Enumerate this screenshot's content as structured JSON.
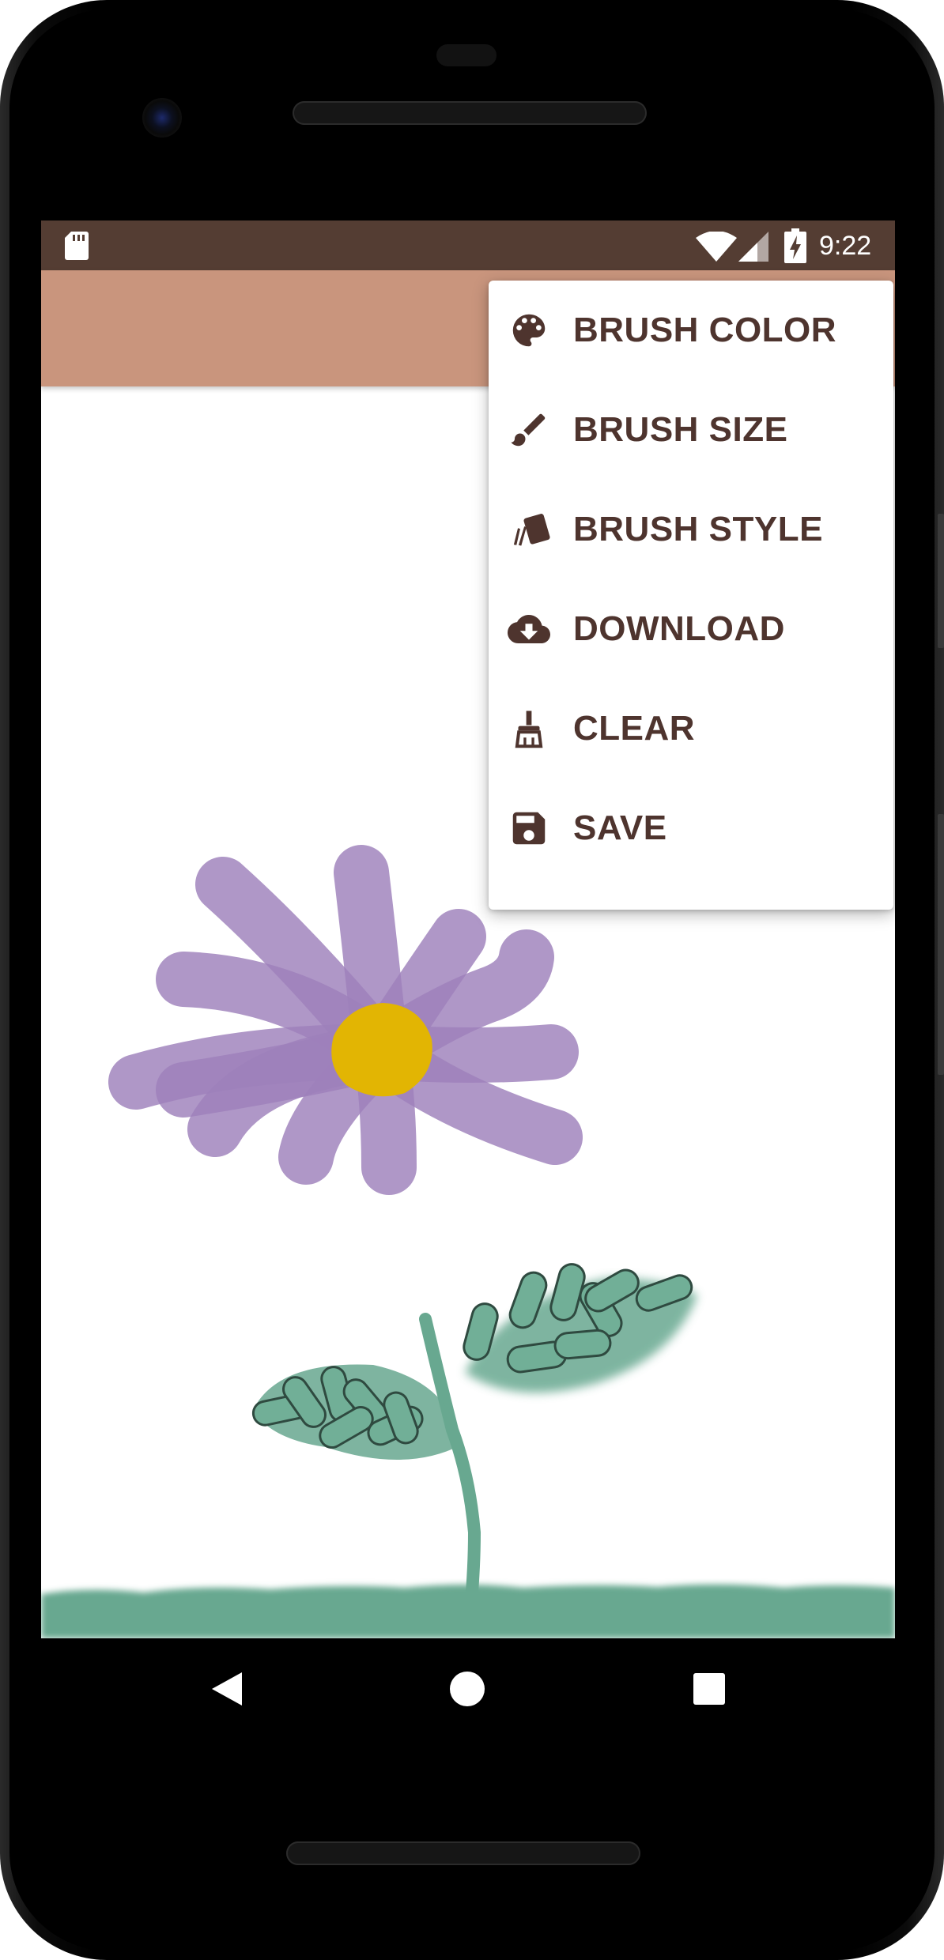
{
  "status_bar": {
    "time": "9:22"
  },
  "menu": {
    "items": [
      {
        "label": "BRUSH COLOR",
        "icon": "palette-icon"
      },
      {
        "label": "BRUSH SIZE",
        "icon": "brush-icon"
      },
      {
        "label": "BRUSH STYLE",
        "icon": "swatches-icon"
      },
      {
        "label": "DOWNLOAD",
        "icon": "cloud-download-icon"
      },
      {
        "label": "CLEAR",
        "icon": "broom-icon"
      },
      {
        "label": "SAVE",
        "icon": "save-icon"
      }
    ]
  },
  "nav_bar": {
    "back": "back-icon",
    "home": "home-icon",
    "recents": "recents-icon"
  },
  "colors": {
    "status_bar": "#543d33",
    "app_bar": "#c9957d",
    "menu_text": "#4e342e",
    "petal": "#9d80bb",
    "flower_center": "#e2b503",
    "stem": "#68a890",
    "ground": "#68a890"
  }
}
